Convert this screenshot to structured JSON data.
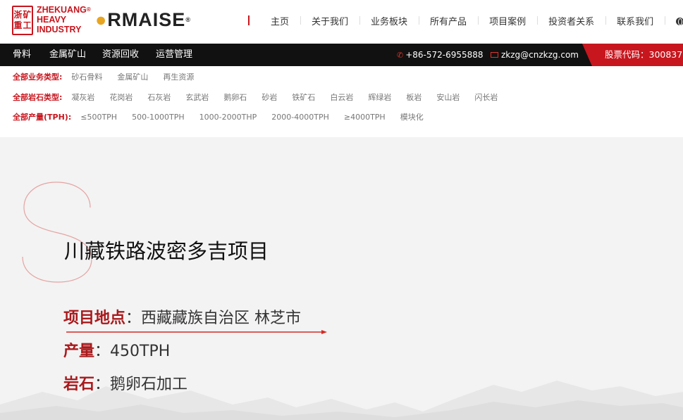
{
  "header": {
    "logo_cn": [
      "浙",
      "矿",
      "重",
      "工"
    ],
    "logo_en": [
      "ZHEKUANG",
      "HEAVY",
      "INDUSTRY"
    ],
    "logo_reg": "®",
    "brand": "ORMAISE",
    "nav": [
      {
        "label": "主页"
      },
      {
        "label": "关于我们"
      },
      {
        "label": "业务板块"
      },
      {
        "label": "所有产品"
      },
      {
        "label": "项目案例"
      },
      {
        "label": "投资者关系"
      },
      {
        "label": "联系我们"
      },
      {
        "label": "语言",
        "icon": "globe-icon"
      }
    ]
  },
  "topbar": {
    "items": [
      "骨料",
      "金属矿山",
      "资源回收",
      "运营管理"
    ],
    "phone": "+86-572-6955888",
    "email": "zkzg@cnzkzg.com",
    "stock": "股票代码：300837"
  },
  "filters": {
    "business": {
      "label": "全部业务类型:",
      "options": [
        "砂石骨料",
        "金属矿山",
        "再生资源"
      ]
    },
    "rock": {
      "label": "全部岩石类型:",
      "options": [
        "凝灰岩",
        "花岗岩",
        "石灰岩",
        "玄武岩",
        "鹅卵石",
        "砂岩",
        "铁矿石",
        "白云岩",
        "辉绿岩",
        "板岩",
        "安山岩",
        "闪长岩"
      ]
    },
    "capacity": {
      "label": "全部产量(TPH):",
      "options": [
        "≤500TPH",
        "500-1000TPH",
        "1000-2000THP",
        "2000-4000TPH",
        "≥4000TPH",
        "模块化"
      ]
    }
  },
  "project": {
    "title": "川藏铁路波密多吉项目",
    "location_key": "项目地点",
    "location_value": "：西藏藏族自治区  林芝市",
    "output_key": "产量",
    "output_value": "：450TPH",
    "rock_key": "岩石",
    "rock_value": "：鹅卵石加工"
  },
  "colors": {
    "brand_red": "#c7161e",
    "accent_orange": "#e8a521",
    "key_red": "#a9191c"
  }
}
